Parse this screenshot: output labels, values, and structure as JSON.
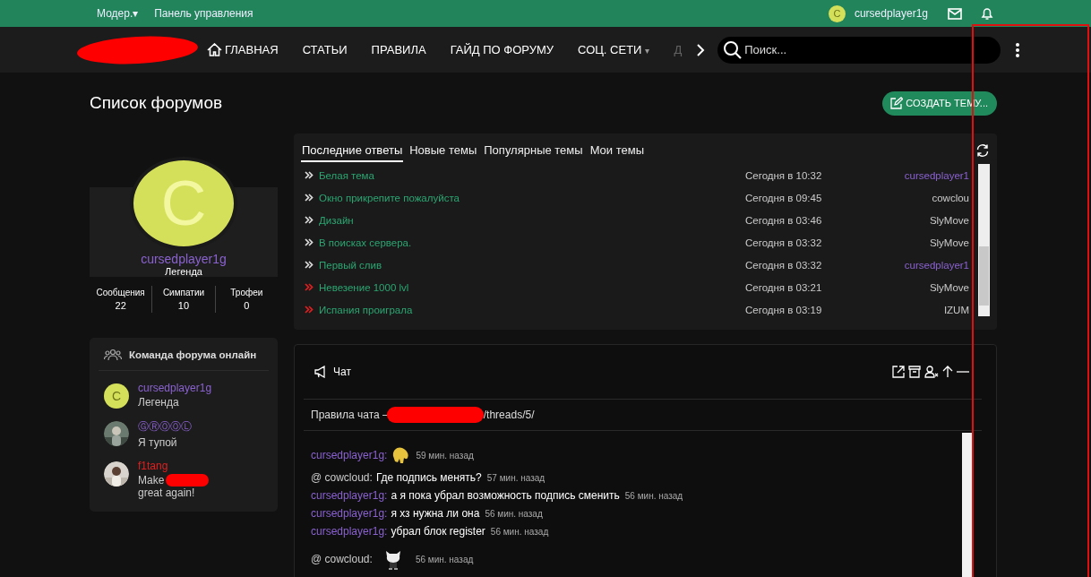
{
  "top_bar": {
    "links": [
      {
        "label": "Модер.",
        "caret": "▾"
      },
      {
        "label": "Панель управления"
      }
    ],
    "user": {
      "initial": "C",
      "name": "cursedplayer1g"
    }
  },
  "nav": {
    "items": [
      {
        "label": "ГЛАВНАЯ",
        "kind": "home"
      },
      {
        "label": "СТАТЬИ",
        "kind": "link"
      },
      {
        "label": "ПРАВИЛА",
        "kind": "link"
      },
      {
        "label": "ГАЙД ПО ФОРУМУ",
        "kind": "link"
      },
      {
        "label": "СОЦ. СЕТИ",
        "kind": "link",
        "caret": "▾"
      },
      {
        "label": "Д",
        "kind": "faded"
      }
    ],
    "search": {
      "placeholder": "Поиск..."
    }
  },
  "page": {
    "title": "Список форумов",
    "create_button": "СОЗДАТЬ ТЕМУ..."
  },
  "profile": {
    "initial": "C",
    "name": "cursedplayer1g",
    "rank": "Легенда",
    "stats": [
      {
        "label": "Сообщения",
        "value": "22"
      },
      {
        "label": "Симпатии",
        "value": "10"
      },
      {
        "label": "Трофеи",
        "value": "0"
      }
    ]
  },
  "team_online": {
    "title": "Команда форума онлайн",
    "members": [
      {
        "name": "cursedplayer1g",
        "kind": "legend",
        "status": [
          "Легенда"
        ],
        "avatar": {
          "kind": "letter",
          "initial": "C"
        }
      },
      {
        "name": "ⒼⓇⓄⓄⓁ",
        "kind": "legend",
        "status": [
          "Я тупой"
        ],
        "avatar": {
          "kind": "picture"
        }
      },
      {
        "name": "f1tang",
        "kind": "admin",
        "status": [
          "Make",
          "great again!"
        ],
        "avatar": {
          "kind": "picture"
        }
      }
    ]
  },
  "topics": {
    "tabs": [
      {
        "label": "Последние ответы",
        "selected": true
      },
      {
        "label": "Новые темы",
        "selected": false
      },
      {
        "label": "Популярные темы",
        "selected": false
      },
      {
        "label": "Мои темы",
        "selected": false
      }
    ],
    "rows": [
      {
        "title": "Белая тема",
        "hot": false,
        "time": "Сегодня в 10:32",
        "author": {
          "name": "cursedplayer1",
          "kind": "legend"
        }
      },
      {
        "title": "Окно прикрепите пожалуйста",
        "hot": false,
        "time": "Сегодня в 09:45",
        "author": {
          "name": "cowclou",
          "kind": "user"
        }
      },
      {
        "title": "Дизайн",
        "hot": false,
        "time": "Сегодня в 03:46",
        "author": {
          "name": "SlyMove",
          "kind": "user"
        }
      },
      {
        "title": "В поисках сервера.",
        "hot": false,
        "time": "Сегодня в 03:32",
        "author": {
          "name": "SlyMove",
          "kind": "user"
        }
      },
      {
        "title": "Первый слив",
        "hot": false,
        "time": "Сегодня в 03:32",
        "author": {
          "name": "cursedplayer1",
          "kind": "legend"
        }
      },
      {
        "title": "Невезение 1000 lvl",
        "hot": true,
        "time": "Сегодня в 03:21",
        "author": {
          "name": "SlyMove",
          "kind": "user"
        }
      },
      {
        "title": "Испания проиграла",
        "hot": true,
        "time": "Сегодня в 03:19",
        "author": {
          "name": "IZUM",
          "kind": "user"
        }
      }
    ]
  },
  "chat": {
    "title": "Чат",
    "rules_label": "Правила чата –",
    "rules_link_tail": "/threads/5/",
    "messages": [
      {
        "author": {
          "name": "cursedplayer1g:",
          "kind": "legend"
        },
        "sticker": {
          "kind": "yellow"
        },
        "time": "59 мин. назад"
      },
      {
        "author": {
          "name": "@ cowcloud:",
          "kind": "user"
        },
        "text": "Где подпись менять?",
        "time": "57 мин. назад"
      },
      {
        "author": {
          "name": "cursedplayer1g:",
          "kind": "legend"
        },
        "text": "а я пока убрал возможность подпись сменить",
        "time": "56 мин. назад"
      },
      {
        "author": {
          "name": "cursedplayer1g:",
          "kind": "legend"
        },
        "text": "я хз нужна ли она",
        "time": "56 мин. назад"
      },
      {
        "author": {
          "name": "cursedplayer1g:",
          "kind": "legend"
        },
        "text": "убрал блок register",
        "time": "56 мин. назад"
      },
      {
        "author": {
          "name": "@ cowcloud:",
          "kind": "user"
        },
        "sticker": {
          "kind": "white"
        },
        "time": "56 мин. назад"
      }
    ]
  }
}
